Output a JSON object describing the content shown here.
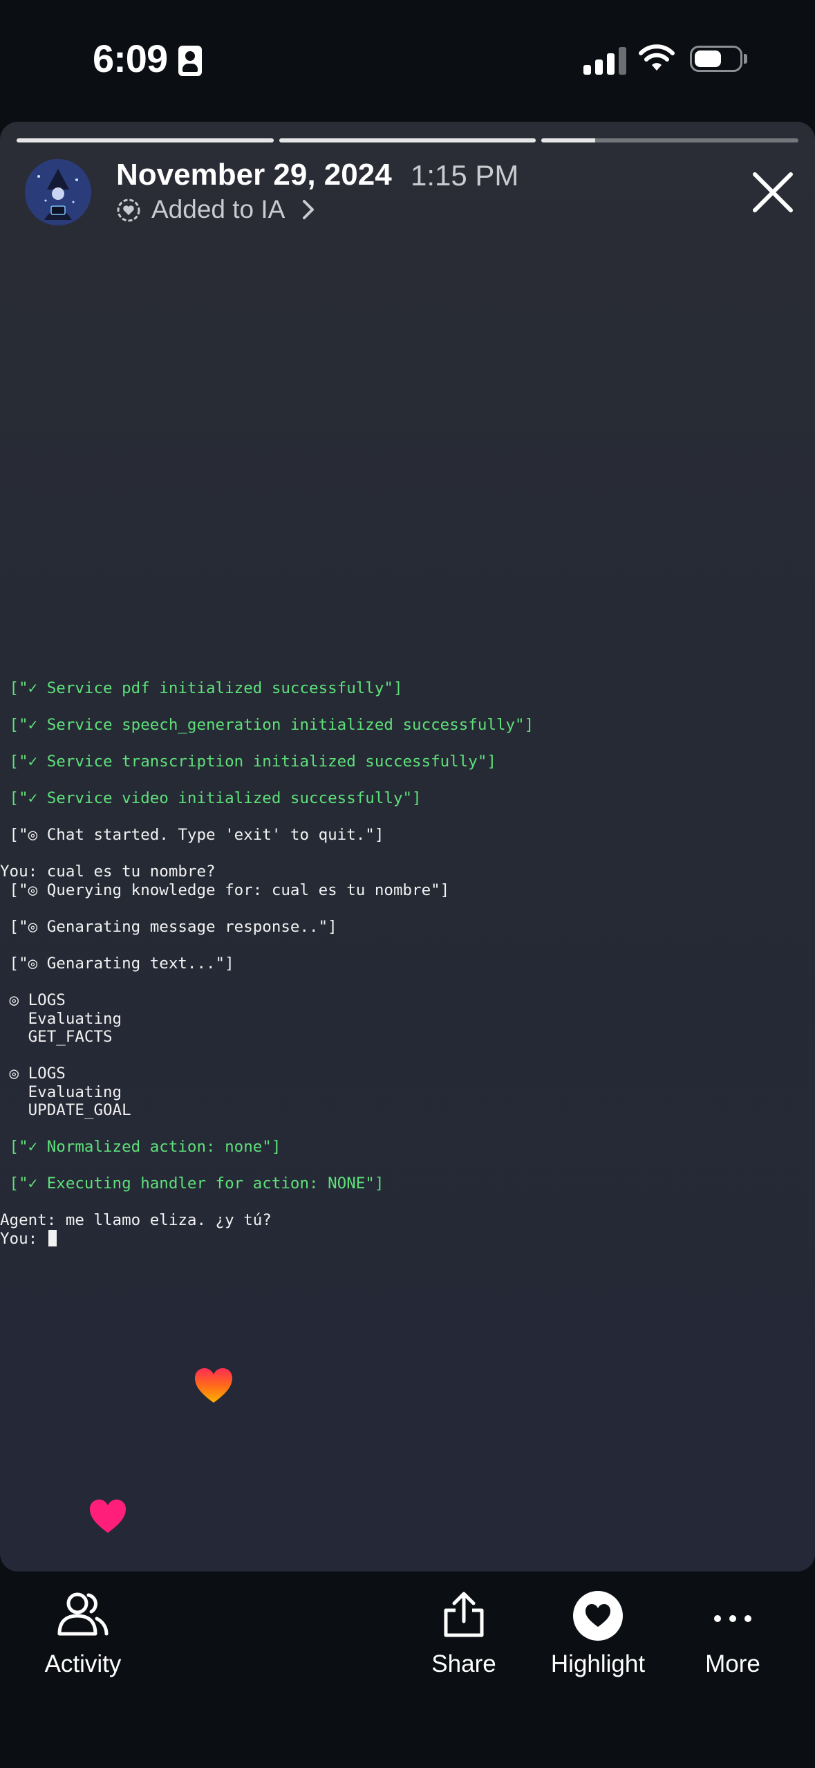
{
  "status_bar": {
    "time": "6:09"
  },
  "header": {
    "date": "November 29, 2024",
    "time": "1:15 PM",
    "album": "Added to IA",
    "story_progress": [
      1,
      1,
      0.21
    ]
  },
  "terminal": {
    "lines": [
      {
        "text": " [\"✓ Service pdf initialized successfully\"]",
        "color": "green"
      },
      {
        "text": " [\"✓ Service speech_generation initialized successfully\"]",
        "color": "green"
      },
      {
        "text": " [\"✓ Service transcription initialized successfully\"]",
        "color": "green"
      },
      {
        "text": " [\"✓ Service video initialized successfully\"]",
        "color": "green"
      },
      {
        "text": " [\"◎ Chat started. Type 'exit' to quit.\"]",
        "color": "white"
      },
      {
        "text": "You: cual es tu nombre?",
        "color": "white"
      },
      {
        "text": " [\"◎ Querying knowledge for: cual es tu nombre\"]",
        "color": "white"
      },
      {
        "text": " [\"◎ Genarating message response..\"]",
        "color": "white"
      },
      {
        "text": " [\"◎ Genarating text...\"]",
        "color": "white"
      },
      {
        "text": " ◎ LOGS",
        "color": "white"
      },
      {
        "text": "   Evaluating",
        "color": "white"
      },
      {
        "text": "   GET_FACTS",
        "color": "white"
      },
      {
        "text": " ◎ LOGS",
        "color": "white"
      },
      {
        "text": "   Evaluating",
        "color": "white"
      },
      {
        "text": "   UPDATE_GOAL",
        "color": "white"
      },
      {
        "text": " [\"✓ Normalized action: none\"]",
        "color": "green"
      },
      {
        "text": " [\"✓ Executing handler for action: NONE\"]",
        "color": "green"
      },
      {
        "text": "Agent: me llamo eliza. ¿y tú?",
        "color": "white"
      },
      {
        "text": "You: ",
        "color": "white",
        "cursor": true
      }
    ]
  },
  "toolbar": {
    "activity_label": "Activity",
    "share_label": "Share",
    "highlight_label": "Highlight",
    "more_label": "More"
  },
  "colors": {
    "terminal_green": "#5ee07a",
    "background": "#0b0e12",
    "card": "#272a35"
  }
}
